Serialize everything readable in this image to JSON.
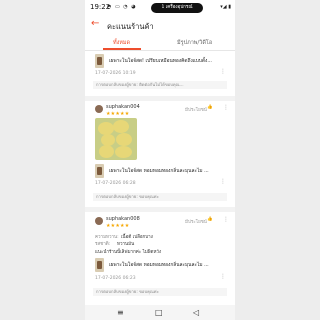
{
  "status": {
    "time": "19:22",
    "icons": "◓ ▭ ◔ ◕",
    "connect_pill": "1 เครื่องอุปกรณ์",
    "right": "▾◢ ▮"
  },
  "header": {
    "back_icon": "←",
    "title": "คะแนนร้านค้า"
  },
  "tabs": {
    "all": "ทั้งหมด",
    "with_media": "มีรูปภาพ/วิดีโอ"
  },
  "reviews": [
    {
      "text": "เผพาะโนโอจ์สด! เปรียบเหมือนทองคิดถึงแบบดั้ง...",
      "date": "17-07-2026 10:19",
      "reply": "การตอบกลับของผู้ขาย: ติดต่อกันไม่ได้ขอบคุณ..."
    },
    {
      "username": "suphakan004",
      "stars": "★★★★★",
      "helpful": "มีประโยชน์",
      "text": "เผพาะโนโอจ์สด หอมหอมทองกลิ่นละมุนละไม ...",
      "date": "17-07-2026 06:28",
      "reply": "การตอบกลับของผู้ขาย: ขอบคุณค่ะ"
    },
    {
      "username": "suphakan008",
      "stars": "★★★★★",
      "helpful": "มีประโยชน์",
      "label1": "ความหวาน:",
      "value1": "เนื้อดี เปลือกบาง",
      "label2": "รสชาติ:",
      "value2": "หวานมัน",
      "text2": "แนะนำร้านนี้เลิฟมากค่ะ ไม่ผิดหวัง",
      "text": "เผพาะโนโอจ์สด หอมหอมทองกลิ่นละมุนละไม ...",
      "date": "17-07-2026 06:23",
      "reply": "การตอบกลับของผู้ขาย: ขอบคุณค่ะ"
    }
  ],
  "nav": {
    "menu": "≡",
    "home": "□",
    "back": "◁"
  },
  "colors": {
    "accent": "#ee4d2d",
    "star": "#f6a700"
  }
}
